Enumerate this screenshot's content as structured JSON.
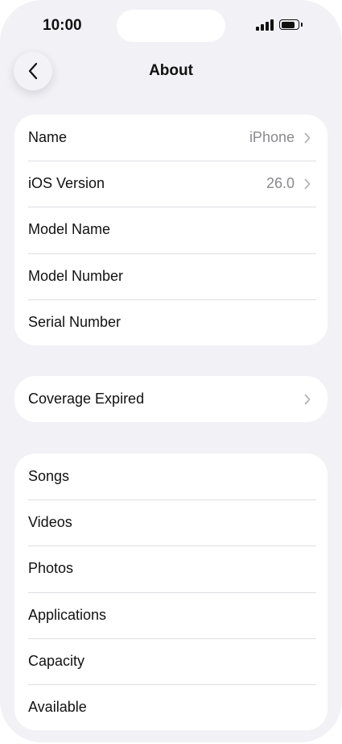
{
  "status_bar": {
    "time": "10:00",
    "battery_level": 0.85,
    "signal_bars": 4
  },
  "nav": {
    "title": "About",
    "back_icon": "chevron-left-icon"
  },
  "groups": [
    {
      "rows": [
        {
          "label": "Name",
          "value": "iPhone",
          "chevron": true
        },
        {
          "label": "iOS Version",
          "value": "26.0",
          "chevron": true
        },
        {
          "label": "Model Name",
          "value": "",
          "chevron": false
        },
        {
          "label": "Model Number",
          "value": "",
          "chevron": false
        },
        {
          "label": "Serial Number",
          "value": "",
          "chevron": false
        }
      ]
    },
    {
      "rows": [
        {
          "label": "Coverage Expired",
          "value": "",
          "chevron": true
        }
      ]
    },
    {
      "rows": [
        {
          "label": "Songs",
          "value": "",
          "chevron": false
        },
        {
          "label": "Videos",
          "value": "",
          "chevron": false
        },
        {
          "label": "Photos",
          "value": "",
          "chevron": false
        },
        {
          "label": "Applications",
          "value": "",
          "chevron": false
        },
        {
          "label": "Capacity",
          "value": "",
          "chevron": false
        },
        {
          "label": "Available",
          "value": "",
          "chevron": false
        }
      ]
    }
  ]
}
